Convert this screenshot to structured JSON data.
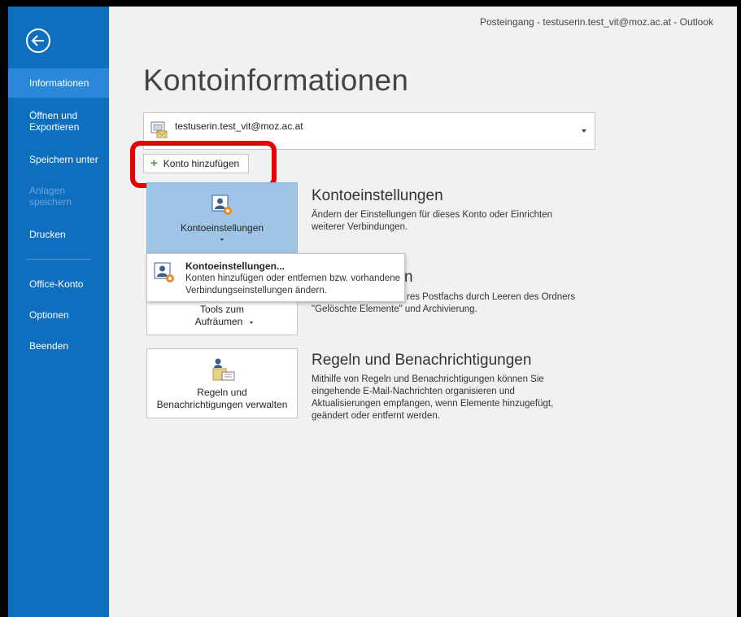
{
  "window": {
    "title": "Posteingang - testuserin.test_vit@moz.ac.at - Outlook"
  },
  "sidebar": {
    "items": [
      {
        "label": "Informationen",
        "active": true
      },
      {
        "label": "Öffnen und Exportieren"
      },
      {
        "label": "Speichern unter"
      },
      {
        "label": "Anlagen speichern",
        "disabled": true
      },
      {
        "label": "Drucken"
      },
      {
        "label": "Office-Konto"
      },
      {
        "label": "Optionen"
      },
      {
        "label": "Beenden"
      }
    ]
  },
  "main": {
    "page_title": "Kontoinformationen",
    "account_selector": {
      "value": "testuserin.test_vit@moz.ac.at"
    },
    "add_account_label": "Konto hinzufügen",
    "sections": [
      {
        "tile_label": "Kontoeinstellungen",
        "title": "Kontoeinstellungen",
        "description": "Ändern der Einstellungen für dieses Konto oder Einrichten weiterer Verbindungen."
      },
      {
        "tile_label_line1": "Tools zum",
        "tile_label_line2": "Aufräumen",
        "title_partial": "umen",
        "description_partial": "res Postfachs durch Leeren des Ordners",
        "description_line2": "\"Gelöschte Elemente\" und Archivierung."
      },
      {
        "tile_label_line1": "Regeln und",
        "tile_label_line2": "Benachrichtigungen verwalten",
        "title": "Regeln und Benachrichtigungen",
        "description": "Mithilfe von Regeln und Benachrichtigungen können Sie eingehende E-Mail-Nachrichten organisieren und Aktualisierungen empfangen, wenn Elemente hinzugefügt, geändert oder entfernt werden."
      }
    ],
    "popup": {
      "title": "Kontoeinstellungen...",
      "description": "Konten hinzufügen oder entfernen bzw. vorhandene Verbindungseinstellungen ändern."
    }
  },
  "colors": {
    "sidebar_bg": "#106ebe",
    "sidebar_active": "#2b88d8",
    "highlight": "#e60000",
    "selected_tile": "#9fc5e6"
  }
}
